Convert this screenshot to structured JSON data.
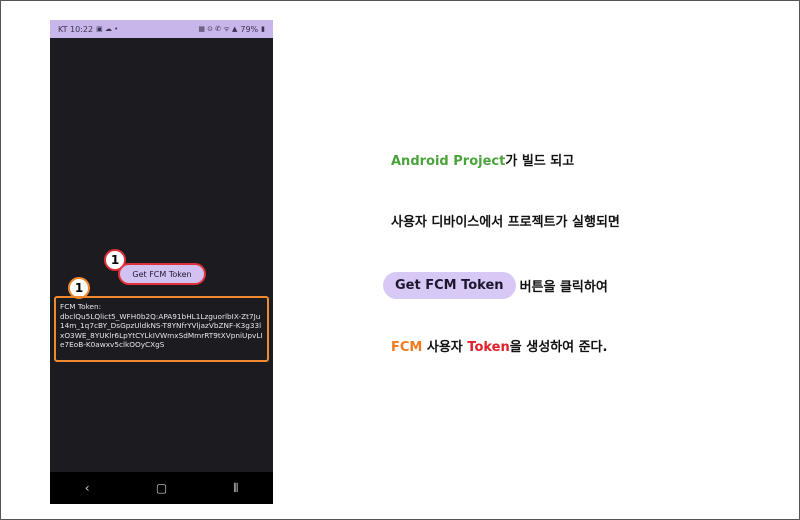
{
  "statusbar": {
    "time": "KT 10:22",
    "left_icons": "▣ ☁ •",
    "right_icons": "▦ ⊙ ✆ ᯤ ▲",
    "battery": "79%"
  },
  "app": {
    "button_label": "Get FCM Token",
    "badge_button": "1",
    "badge_token": "1",
    "token_label": "FCM Token:",
    "token_value": "dbclQu5LQlict5_WFH0b2Q:APA91bHL1LzguorlbIX-Zt7Ju14m_1q7cBY_DsGpzUldkNS-T8YNfrYVljazVbZNF-K3g33lxO3WE_8YUKlr6LpYtCYLkIVWmxSdMmrRT9tXVpniUpvLIe7EoB-K0awxv5clkOOyCXgS"
  },
  "navbar": {
    "back": "‹",
    "home": "▢",
    "recents": "⦀"
  },
  "annotations": {
    "line1_highlight": "Android Project",
    "line1_rest": "가 빌드 되고",
    "line2": "사용자 디바이스에서 프로젝트가 실행되면",
    "line3_button": "Get FCM Token",
    "line3_rest": "버튼을 클릭하여",
    "line4_fcm": "FCM",
    "line4_mid": " 사용자 ",
    "line4_token": "Token",
    "line4_rest": "을 생성하여 준다."
  },
  "colors": {
    "statusbar": "#c8b6ea",
    "phone_bg": "#1c1b1f",
    "button_bg": "#d2c2f2",
    "highlight_green": "#4aa33b",
    "highlight_orange": "#f07a1e",
    "highlight_red": "#e0202a",
    "pill_bg": "#d7c8f5"
  }
}
